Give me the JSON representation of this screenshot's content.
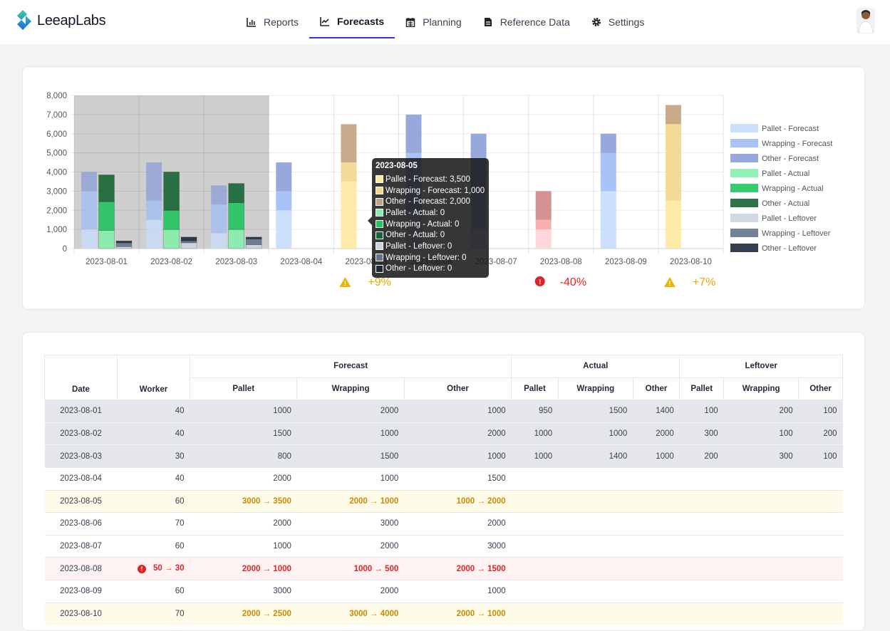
{
  "app": {
    "name": "LeeapLabs"
  },
  "nav": [
    {
      "label": "Reports",
      "icon": "bar-chart-icon",
      "active": false
    },
    {
      "label": "Forecasts",
      "icon": "line-chart-icon",
      "active": true
    },
    {
      "label": "Planning",
      "icon": "calendar-icon",
      "active": false
    },
    {
      "label": "Reference Data",
      "icon": "document-icon",
      "active": false
    },
    {
      "label": "Settings",
      "icon": "gear-icon",
      "active": false
    }
  ],
  "colors": {
    "accent": "#3730e0",
    "warning": "#eab308",
    "error": "#dc2626"
  },
  "chart_data": {
    "type": "bar",
    "stacked": true,
    "categories": [
      "2023-08-01",
      "2023-08-02",
      "2023-08-03",
      "2023-08-04",
      "2023-08-05",
      "2023-08-06",
      "2023-08-07",
      "2023-08-08",
      "2023-08-09",
      "2023-08-10"
    ],
    "ylim": [
      0,
      8000
    ],
    "yticks": [
      "0",
      "1,000",
      "2,000",
      "3,000",
      "4,000",
      "5,000",
      "6,000",
      "7,000",
      "8,000"
    ],
    "past_days": 3,
    "legend_position": "right",
    "legend": [
      {
        "label": "Pallet - Forecast",
        "color": "#c7dcfc"
      },
      {
        "label": "Wrapping - Forecast",
        "color": "#9dbdf6"
      },
      {
        "label": "Other - Forecast",
        "color": "#8b9fd8"
      },
      {
        "label": "Pallet - Actual",
        "color": "#86efac"
      },
      {
        "label": "Wrapping - Actual",
        "color": "#22c55e"
      },
      {
        "label": "Other - Actual",
        "color": "#166534"
      },
      {
        "label": "Pallet - Leftover",
        "color": "#cbd5e1"
      },
      {
        "label": "Wrapping - Leftover",
        "color": "#64748b"
      },
      {
        "label": "Other - Leftover",
        "color": "#1e293b"
      }
    ],
    "forecast": [
      [
        1000,
        2000,
        1000
      ],
      [
        1500,
        1000,
        2000
      ],
      [
        800,
        1500,
        1000
      ],
      [
        2000,
        1000,
        1500
      ],
      [
        3500,
        1000,
        2000
      ],
      [
        2000,
        3000,
        2000
      ],
      [
        1000,
        2000,
        3000
      ],
      [
        1000,
        500,
        1500
      ],
      [
        3000,
        2000,
        1000
      ],
      [
        2500,
        4000,
        1000
      ]
    ],
    "actual": [
      [
        950,
        1500,
        1400
      ],
      [
        1000,
        1000,
        2000
      ],
      [
        1000,
        1400,
        1000
      ],
      [
        0,
        0,
        0
      ],
      [
        0,
        0,
        0
      ],
      [
        0,
        0,
        0
      ],
      [
        0,
        0,
        0
      ],
      [
        0,
        0,
        0
      ],
      [
        0,
        0,
        0
      ],
      [
        0,
        0,
        0
      ]
    ],
    "leftover": [
      [
        100,
        200,
        100
      ],
      [
        300,
        100,
        200
      ],
      [
        200,
        300,
        100
      ],
      [
        0,
        0,
        0
      ],
      [
        0,
        0,
        0
      ],
      [
        0,
        0,
        0
      ],
      [
        0,
        0,
        0
      ],
      [
        0,
        0,
        0
      ],
      [
        0,
        0,
        0
      ],
      [
        0,
        0,
        0
      ]
    ],
    "status": [
      "normal",
      "normal",
      "normal",
      "normal",
      "warning",
      "normal",
      "normal",
      "error",
      "normal",
      "warning"
    ],
    "status_colors": {
      "warning": [
        "#fde9a0",
        "#f3d68c",
        "#c3a27f"
      ],
      "error": [
        "#fdd3d5",
        "#f9a6a6",
        "#cd8686"
      ]
    },
    "annotations": [
      {
        "date": "2023-08-05",
        "type": "warning",
        "text": "+9%"
      },
      {
        "date": "2023-08-08",
        "type": "error",
        "text": "-40%"
      },
      {
        "date": "2023-08-10",
        "type": "warning",
        "text": "+7%"
      }
    ]
  },
  "tooltip": {
    "title": "2023-08-05",
    "rows": [
      {
        "label": "Pallet - Forecast: 3,500",
        "color": "#fde9a0"
      },
      {
        "label": "Wrapping - Forecast: 1,000",
        "color": "#f3d68c"
      },
      {
        "label": "Other - Forecast: 2,000",
        "color": "#c3a27f"
      },
      {
        "label": "Pallet - Actual: 0",
        "color": "#86efac"
      },
      {
        "label": "Wrapping - Actual: 0",
        "color": "#22c55e"
      },
      {
        "label": "Other - Actual: 0",
        "color": "#166534"
      },
      {
        "label": "Pallet - Leftover: 0",
        "color": "#cbd5e1"
      },
      {
        "label": "Wrapping - Leftover: 0",
        "color": "#64748b"
      },
      {
        "label": "Other - Leftover: 0",
        "color": "#1e293b"
      }
    ]
  },
  "table": {
    "headers": {
      "date": "Date",
      "worker": "Worker",
      "groups": [
        "Forecast",
        "Actual",
        "Leftover"
      ],
      "sub": [
        "Pallet",
        "Wrapping",
        "Other"
      ]
    },
    "rows": [
      {
        "type": "past",
        "cells": [
          "2023-08-01",
          "40",
          "1000",
          "2000",
          "1000",
          "950",
          "1500",
          "1400",
          "100",
          "200",
          "100"
        ]
      },
      {
        "type": "past",
        "cells": [
          "2023-08-02",
          "40",
          "1500",
          "1000",
          "2000",
          "1000",
          "1000",
          "2000",
          "300",
          "100",
          "200"
        ]
      },
      {
        "type": "past",
        "cells": [
          "2023-08-03",
          "30",
          "800",
          "1500",
          "1000",
          "1000",
          "1400",
          "1000",
          "200",
          "300",
          "100"
        ]
      },
      {
        "type": "normal",
        "cells": [
          "2023-08-04",
          "40",
          "2000",
          "1000",
          "1500",
          "",
          "",
          "",
          "",
          "",
          ""
        ]
      },
      {
        "type": "warn",
        "cells": [
          "2023-08-05",
          "60",
          "3000 → 3500",
          "2000 → 1000",
          "1000 → 2000",
          "",
          "",
          "",
          "",
          "",
          ""
        ]
      },
      {
        "type": "normal",
        "cells": [
          "2023-08-06",
          "70",
          "2000",
          "3000",
          "2000",
          "",
          "",
          "",
          "",
          "",
          ""
        ]
      },
      {
        "type": "normal",
        "cells": [
          "2023-08-07",
          "60",
          "1000",
          "2000",
          "3000",
          "",
          "",
          "",
          "",
          "",
          ""
        ]
      },
      {
        "type": "err",
        "cells": [
          "2023-08-08",
          "50 → 30",
          "2000 → 1000",
          "1000 → 500",
          "2000 → 1500",
          "",
          "",
          "",
          "",
          "",
          ""
        ]
      },
      {
        "type": "normal",
        "cells": [
          "2023-08-09",
          "60",
          "3000",
          "2000",
          "1000",
          "",
          "",
          "",
          "",
          "",
          ""
        ]
      },
      {
        "type": "warn",
        "cells": [
          "2023-08-10",
          "70",
          "2000 → 2500",
          "3000 → 4000",
          "2000 → 1000",
          "",
          "",
          "",
          "",
          "",
          ""
        ]
      }
    ]
  }
}
